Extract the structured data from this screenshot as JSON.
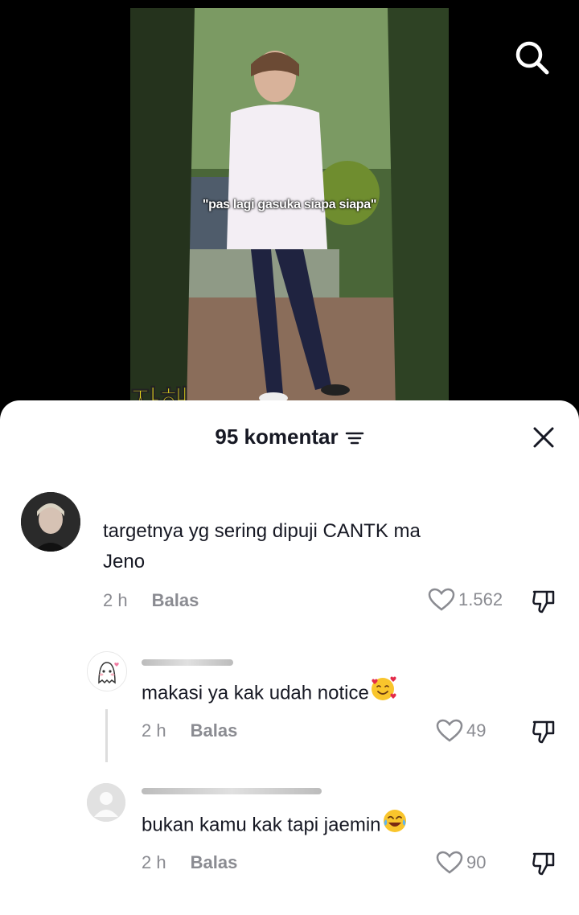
{
  "video": {
    "caption": "\"pas lagi gasuka siapa siapa\"",
    "overlay_text": "자해"
  },
  "comments_sheet": {
    "title": "95 komentar"
  },
  "comments": [
    {
      "text_line1": "targetnya yg sering dipuji CANTK ma",
      "text_line2": "Jeno",
      "time": "2 h",
      "reply_label": "Balas",
      "likes": "1.562"
    }
  ],
  "replies": [
    {
      "text": "makasi ya kak udah notice",
      "emoji": "smiling-face-with-hearts",
      "time": "2 h",
      "reply_label": "Balas",
      "likes": "49"
    },
    {
      "text": "bukan kamu kak tapi jaemin",
      "emoji": "face-with-tears-of-joy",
      "time": "2 h",
      "reply_label": "Balas",
      "likes": "90"
    }
  ]
}
